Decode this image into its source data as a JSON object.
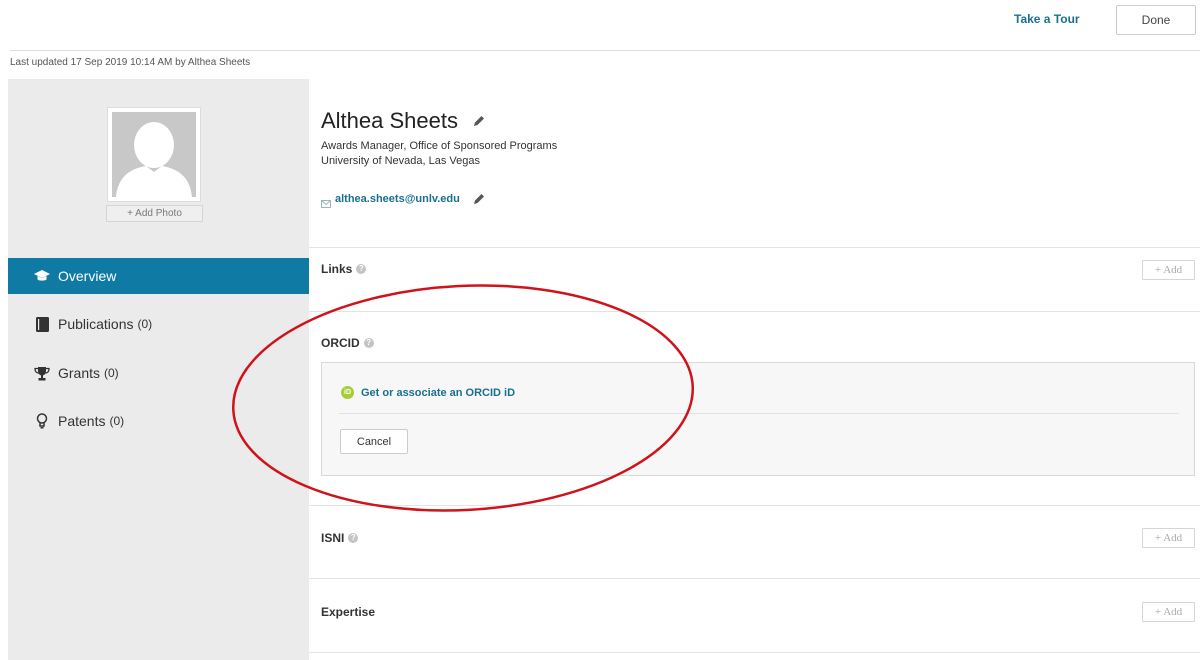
{
  "header": {
    "take_tour": "Take a Tour",
    "done": "Done",
    "last_updated": "Last updated 17 Sep 2019 10:14 AM by Althea Sheets"
  },
  "sidebar": {
    "add_photo": "+ Add Photo",
    "items": [
      {
        "label": "Overview",
        "count": "",
        "icon": "graduation-cap-icon"
      },
      {
        "label": "Publications",
        "count": "(0)",
        "icon": "book-icon"
      },
      {
        "label": "Grants",
        "count": "(0)",
        "icon": "trophy-icon"
      },
      {
        "label": "Patents",
        "count": "(0)",
        "icon": "lightbulb-icon"
      }
    ]
  },
  "profile": {
    "name": "Althea Sheets",
    "title": "Awards Manager, Office of Sponsored Programs",
    "institution": "University of Nevada, Las Vegas",
    "email": "althea.sheets@unlv.edu"
  },
  "sections": {
    "links": {
      "title": "Links",
      "add": "+ Add"
    },
    "orcid": {
      "title": "ORCID",
      "link": "Get or associate an ORCID iD",
      "cancel": "Cancel"
    },
    "isni": {
      "title": "ISNI",
      "add": "+ Add"
    },
    "expertise": {
      "title": "Expertise",
      "add": "+ Add"
    }
  },
  "colors": {
    "accent": "#0f7aa4",
    "link": "#1a6f8f",
    "orcid_green": "#a6ce39",
    "annotation_red": "#d0121b"
  }
}
